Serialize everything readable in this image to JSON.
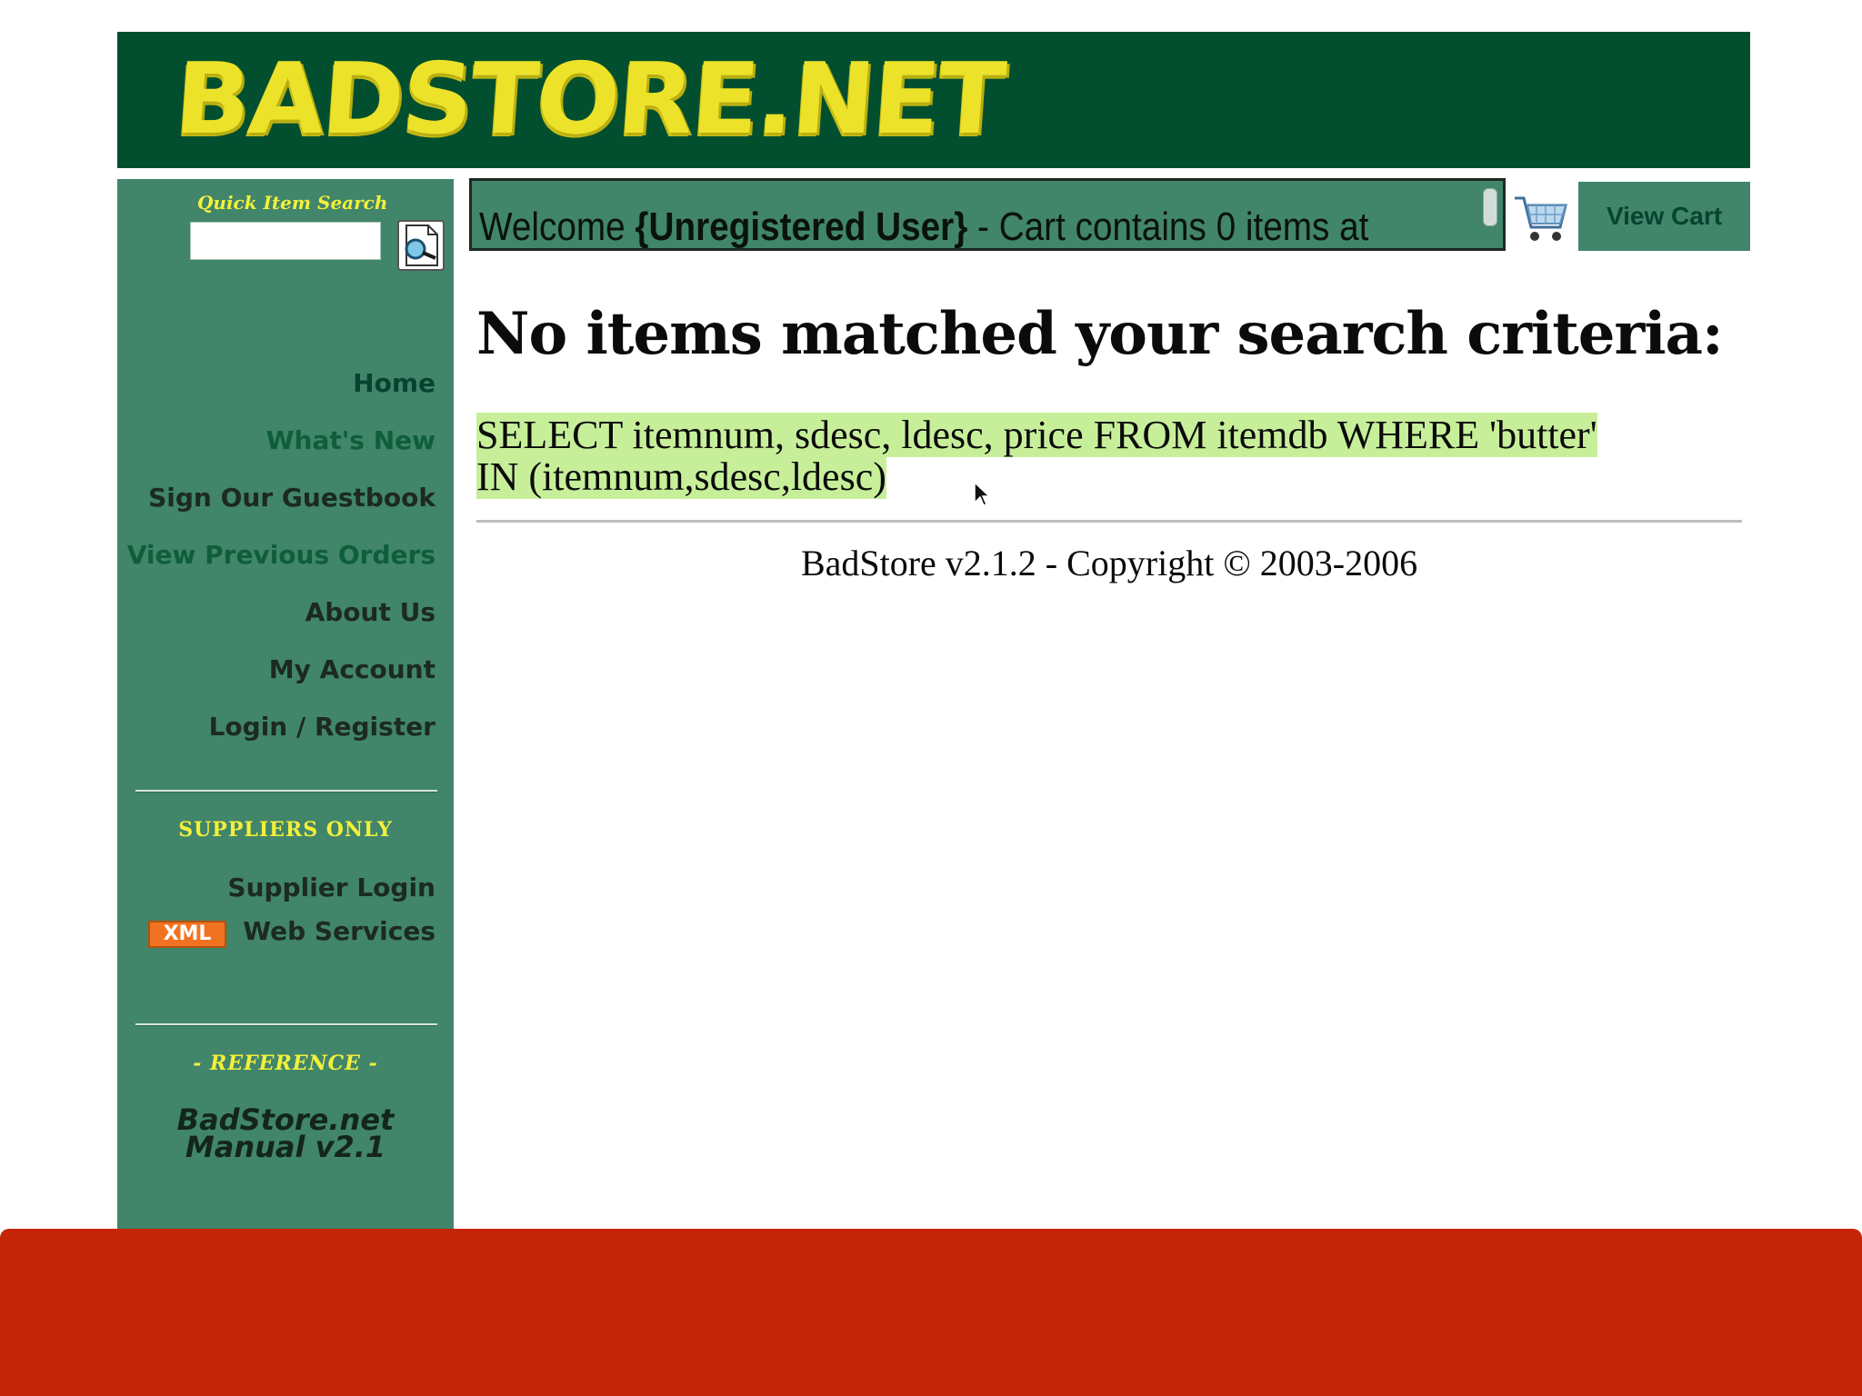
{
  "header": {
    "logo_text": "BADSTORE.NET"
  },
  "sidebar": {
    "quick_search_label": "Quick Item Search",
    "quick_search_value": "",
    "nav_items": [
      {
        "label": "Home"
      },
      {
        "label": "What's New"
      },
      {
        "label": "Sign Our Guestbook"
      },
      {
        "label": "View Previous Orders"
      },
      {
        "label": "About Us"
      },
      {
        "label": "My Account"
      },
      {
        "label": "Login / Register"
      }
    ],
    "suppliers_heading": "SUPPLIERS ONLY",
    "supplier_login": "Supplier Login",
    "xml_badge": "XML",
    "web_services": "Web Services",
    "reference_heading": "- REFERENCE -",
    "manual_line1": "BadStore.net",
    "manual_line2": "Manual v2.1"
  },
  "welcome_bar": {
    "prefix": "Welcome ",
    "user": "{Unregistered User}",
    "suffix": " - Cart contains 0 items at"
  },
  "cart": {
    "icon": "shopping-cart-icon",
    "view_cart_label": "View Cart"
  },
  "main": {
    "heading": "No items matched your search criteria:",
    "sql_line1": "SELECT itemnum, sdesc, ldesc, price FROM itemdb WHERE 'butter'",
    "sql_line2": "IN (itemnum,sdesc,ldesc)",
    "footer": "BadStore v2.1.2 - Copyright © 2003-2006"
  },
  "colors": {
    "banner": "#024f2f",
    "sidebar": "#41856b",
    "logo": "#ece22a",
    "highlight": "#c7ef9a",
    "bottom_bar": "#c52508",
    "xml_badge": "#f17321"
  }
}
